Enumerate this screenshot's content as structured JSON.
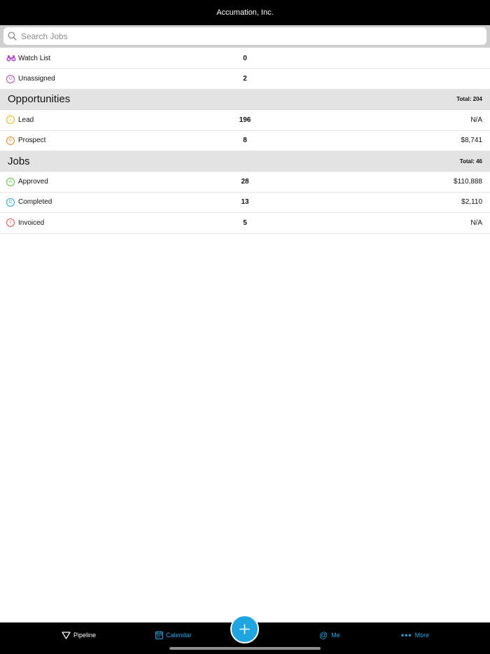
{
  "header": {
    "title": "Accumation, Inc."
  },
  "search": {
    "placeholder": "Search Jobs",
    "value": ""
  },
  "top_rows": [
    {
      "label": "Watch List",
      "count": "0",
      "value": "",
      "icon": "binoculars-icon"
    },
    {
      "label": "Unassigned",
      "count": "2",
      "value": "",
      "badge": "U",
      "color": "#b24bd1"
    }
  ],
  "opportunities": {
    "title": "Opportunities",
    "total": "Total: 204",
    "rows": [
      {
        "label": "Lead",
        "count": "196",
        "value": "N/A",
        "badge": "L",
        "color": "#e9b81c"
      },
      {
        "label": "Prospect",
        "count": "8",
        "value": "$8,741",
        "badge": "P",
        "color": "#e88b2a"
      }
    ]
  },
  "jobs": {
    "title": "Jobs",
    "total": "Total: 46",
    "rows": [
      {
        "label": "Approved",
        "count": "28",
        "value": "$110,888",
        "badge": "A",
        "color": "#5cbf3a"
      },
      {
        "label": "Completed",
        "count": "13",
        "value": "$2,110",
        "badge": "C",
        "color": "#2aa3e0"
      },
      {
        "label": "Invoiced",
        "count": "5",
        "value": "N/A",
        "badge": "I",
        "color": "#e0514f"
      }
    ]
  },
  "tabs": {
    "pipeline": "Pipeline",
    "calendar": "Calendar",
    "me": "Me",
    "more": "More"
  },
  "colors": {
    "accent": "#1fa5df",
    "binoculars": "#b24bd1"
  }
}
